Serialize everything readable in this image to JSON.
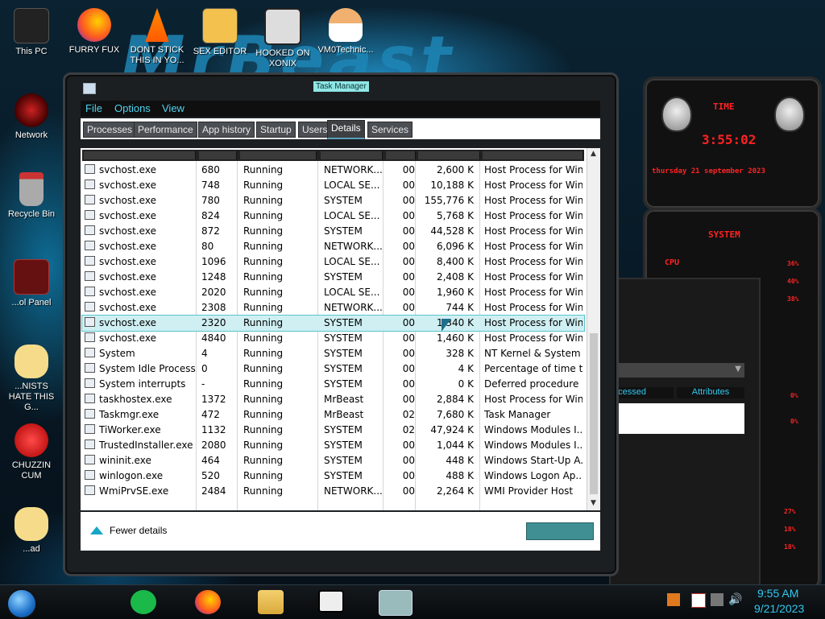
{
  "desktop": {
    "wallpaper_text": "MrBeast",
    "icons": [
      {
        "label": "This PC"
      },
      {
        "label": "FURRY FUX"
      },
      {
        "label": "DONT STICK THIS IN YO..."
      },
      {
        "label": "SEX EDITOR"
      },
      {
        "label": "HOOKED ON XONIX"
      },
      {
        "label": "VM0Technic..."
      },
      {
        "label": "Network"
      },
      {
        "label": "Recycle Bin"
      },
      {
        "label": "...ol Panel"
      },
      {
        "label": "...NISTS HATE THIS G..."
      },
      {
        "label": "CHUZZIN CUM"
      },
      {
        "label": "...ad"
      }
    ]
  },
  "gadget": {
    "time_label": "TIME",
    "time": "3:55:02",
    "date": "thursday 21 september 2023",
    "system_label": "SYSTEM",
    "cpu_label": "CPU",
    "percents": [
      "36%",
      "40%",
      "38%",
      "0%",
      "0%",
      "27%",
      "18%",
      "18%"
    ]
  },
  "background_window": {
    "col1": "...cessed",
    "col2": "Attributes"
  },
  "task_manager": {
    "title": "Task Manager",
    "menu": [
      "File",
      "Options",
      "View"
    ],
    "tabs": [
      "Processes",
      "Performance",
      "App history",
      "Startup",
      "Users",
      "Details",
      "Services"
    ],
    "active_tab": "Details",
    "rows": [
      {
        "name": "svchost.exe",
        "pid": "680",
        "status": "Running",
        "user": "NETWORK...",
        "cpu": "00",
        "mem": "2,600 K",
        "desc": "Host Process for Win..."
      },
      {
        "name": "svchost.exe",
        "pid": "748",
        "status": "Running",
        "user": "LOCAL SE...",
        "cpu": "00",
        "mem": "10,188 K",
        "desc": "Host Process for Win..."
      },
      {
        "name": "svchost.exe",
        "pid": "780",
        "status": "Running",
        "user": "SYSTEM",
        "cpu": "00",
        "mem": "155,776 K",
        "desc": "Host Process for Win..."
      },
      {
        "name": "svchost.exe",
        "pid": "824",
        "status": "Running",
        "user": "LOCAL SE...",
        "cpu": "00",
        "mem": "5,768 K",
        "desc": "Host Process for Win..."
      },
      {
        "name": "svchost.exe",
        "pid": "872",
        "status": "Running",
        "user": "SYSTEM",
        "cpu": "00",
        "mem": "44,528 K",
        "desc": "Host Process for Win..."
      },
      {
        "name": "svchost.exe",
        "pid": "80",
        "status": "Running",
        "user": "NETWORK...",
        "cpu": "00",
        "mem": "6,096 K",
        "desc": "Host Process for Win..."
      },
      {
        "name": "svchost.exe",
        "pid": "1096",
        "status": "Running",
        "user": "LOCAL SE...",
        "cpu": "00",
        "mem": "8,400 K",
        "desc": "Host Process for Win..."
      },
      {
        "name": "svchost.exe",
        "pid": "1248",
        "status": "Running",
        "user": "SYSTEM",
        "cpu": "00",
        "mem": "2,408 K",
        "desc": "Host Process for Win..."
      },
      {
        "name": "svchost.exe",
        "pid": "2020",
        "status": "Running",
        "user": "LOCAL SE...",
        "cpu": "00",
        "mem": "1,960 K",
        "desc": "Host Process for Win..."
      },
      {
        "name": "svchost.exe",
        "pid": "2308",
        "status": "Running",
        "user": "NETWORK...",
        "cpu": "00",
        "mem": "744 K",
        "desc": "Host Process for Win..."
      },
      {
        "name": "svchost.exe",
        "pid": "2320",
        "status": "Running",
        "user": "SYSTEM",
        "cpu": "00",
        "mem": "1,340 K",
        "desc": "Host Process for Win...",
        "selected": true
      },
      {
        "name": "svchost.exe",
        "pid": "4840",
        "status": "Running",
        "user": "SYSTEM",
        "cpu": "00",
        "mem": "1,460 K",
        "desc": "Host Process for Win..."
      },
      {
        "name": "System",
        "pid": "4",
        "status": "Running",
        "user": "SYSTEM",
        "cpu": "00",
        "mem": "328 K",
        "desc": "NT Kernel & System"
      },
      {
        "name": "System Idle Process",
        "pid": "0",
        "status": "Running",
        "user": "SYSTEM",
        "cpu": "00",
        "mem": "4 K",
        "desc": "Percentage of time t..."
      },
      {
        "name": "System interrupts",
        "pid": "-",
        "status": "Running",
        "user": "SYSTEM",
        "cpu": "00",
        "mem": "0 K",
        "desc": "Deferred procedure ..."
      },
      {
        "name": "taskhostex.exe",
        "pid": "1372",
        "status": "Running",
        "user": "MrBeast",
        "cpu": "00",
        "mem": "2,884 K",
        "desc": "Host Process for Win..."
      },
      {
        "name": "Taskmgr.exe",
        "pid": "472",
        "status": "Running",
        "user": "MrBeast",
        "cpu": "02",
        "mem": "7,680 K",
        "desc": "Task Manager"
      },
      {
        "name": "TiWorker.exe",
        "pid": "1132",
        "status": "Running",
        "user": "SYSTEM",
        "cpu": "02",
        "mem": "47,924 K",
        "desc": "Windows Modules I..."
      },
      {
        "name": "TrustedInstaller.exe",
        "pid": "2080",
        "status": "Running",
        "user": "SYSTEM",
        "cpu": "00",
        "mem": "1,044 K",
        "desc": "Windows Modules I..."
      },
      {
        "name": "wininit.exe",
        "pid": "464",
        "status": "Running",
        "user": "SYSTEM",
        "cpu": "00",
        "mem": "448 K",
        "desc": "Windows Start-Up A..."
      },
      {
        "name": "winlogon.exe",
        "pid": "520",
        "status": "Running",
        "user": "SYSTEM",
        "cpu": "00",
        "mem": "488 K",
        "desc": "Windows Logon Ap..."
      },
      {
        "name": "WmiPrvSE.exe",
        "pid": "2484",
        "status": "Running",
        "user": "NETWORK...",
        "cpu": "00",
        "mem": "2,264 K",
        "desc": "WMI Provider Host"
      }
    ],
    "fewer_details": "Fewer details"
  },
  "taskbar": {
    "time": "9:55 AM",
    "date": "9/21/2023"
  },
  "colors": {
    "accent": "#31c7ee",
    "menu_text": "#4fd2ee",
    "selection": "#cfeff2",
    "gadget_red": "#ff2222"
  }
}
